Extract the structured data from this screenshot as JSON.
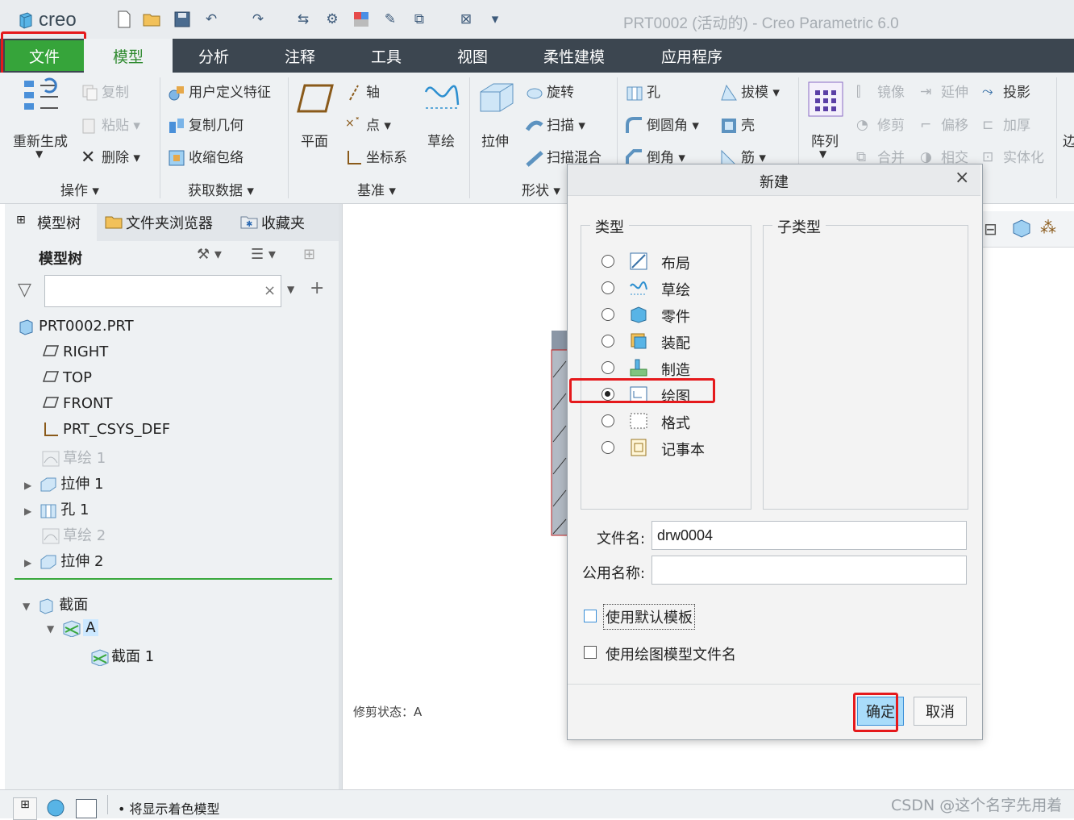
{
  "app": {
    "logo_text": "creo",
    "window_title": "PRT0002 (活动的) - Creo Parametric 6.0"
  },
  "menu": [
    "文件",
    "模型",
    "分析",
    "注释",
    "工具",
    "视图",
    "柔性建模",
    "应用程序"
  ],
  "ribbon": {
    "ops": {
      "regenerate": "重新生成",
      "copy": "复制",
      "paste": "粘贴",
      "delete": "删除",
      "group": "操作"
    },
    "getdata": {
      "udf": "用户定义特征",
      "copy_geom": "复制几何",
      "shrinkwrap": "收缩包络",
      "group": "获取数据"
    },
    "datum": {
      "plane": "平面",
      "axis": "轴",
      "point": "点",
      "csys": "坐标系",
      "sketch": "草绘",
      "group": "基准"
    },
    "shapes": {
      "extrude": "拉伸",
      "revolve": "旋转",
      "sweep": "扫描",
      "blend": "扫描混合",
      "group": "形状"
    },
    "eng": {
      "hole": "孔",
      "round": "倒圆角",
      "chamfer": "倒角",
      "draft": "拔模",
      "shell": "壳",
      "rib": "筋"
    },
    "edit": {
      "pattern": "阵列",
      "mirror": "镜像",
      "trim": "修剪",
      "merge": "合并",
      "extend": "延伸",
      "offset": "偏移",
      "intersect": "相交",
      "project": "投影",
      "thicken": "加厚",
      "solidify": "实体化",
      "cut": "边"
    }
  },
  "leftpanel": {
    "tabs": [
      "模型树",
      "文件夹浏览器",
      "收藏夹"
    ],
    "tree_title": "模型树",
    "search_placeholder": "",
    "items": [
      {
        "label": "PRT0002.PRT"
      },
      {
        "label": "RIGHT"
      },
      {
        "label": "TOP"
      },
      {
        "label": "FRONT"
      },
      {
        "label": "PRT_CSYS_DEF"
      },
      {
        "label": "草绘 1"
      },
      {
        "label": "拉伸 1"
      },
      {
        "label": "孔 1"
      },
      {
        "label": "草绘 2"
      },
      {
        "label": "拉伸 2"
      },
      {
        "label": "截面"
      },
      {
        "label": "A"
      },
      {
        "label": "截面 1"
      }
    ]
  },
  "graphic": {
    "status_text": "修剪状态：A"
  },
  "status": {
    "message": "将显示着色模型",
    "watermark": "CSDN @这个名字先用着"
  },
  "dialog": {
    "title": "新建",
    "type_label": "类型",
    "subtype_label": "子类型",
    "types": [
      {
        "label": "布局",
        "selected": false
      },
      {
        "label": "草绘",
        "selected": false
      },
      {
        "label": "零件",
        "selected": false
      },
      {
        "label": "装配",
        "selected": false
      },
      {
        "label": "制造",
        "selected": false
      },
      {
        "label": "绘图",
        "selected": true
      },
      {
        "label": "格式",
        "selected": false
      },
      {
        "label": "记事本",
        "selected": false
      }
    ],
    "filename_label": "文件名:",
    "filename_value": "drw0004",
    "common_name_label": "公用名称:",
    "common_name_value": "",
    "use_default_template": "使用默认模板",
    "use_drawing_model_name": "使用绘图模型文件名",
    "ok": "确定",
    "cancel": "取消",
    "close_icon": "×"
  },
  "colors": {
    "menubar": "#3c4650",
    "file_green": "#36a43a",
    "highlight_red": "#e5191c",
    "selected_blue": "#cce8ff"
  }
}
